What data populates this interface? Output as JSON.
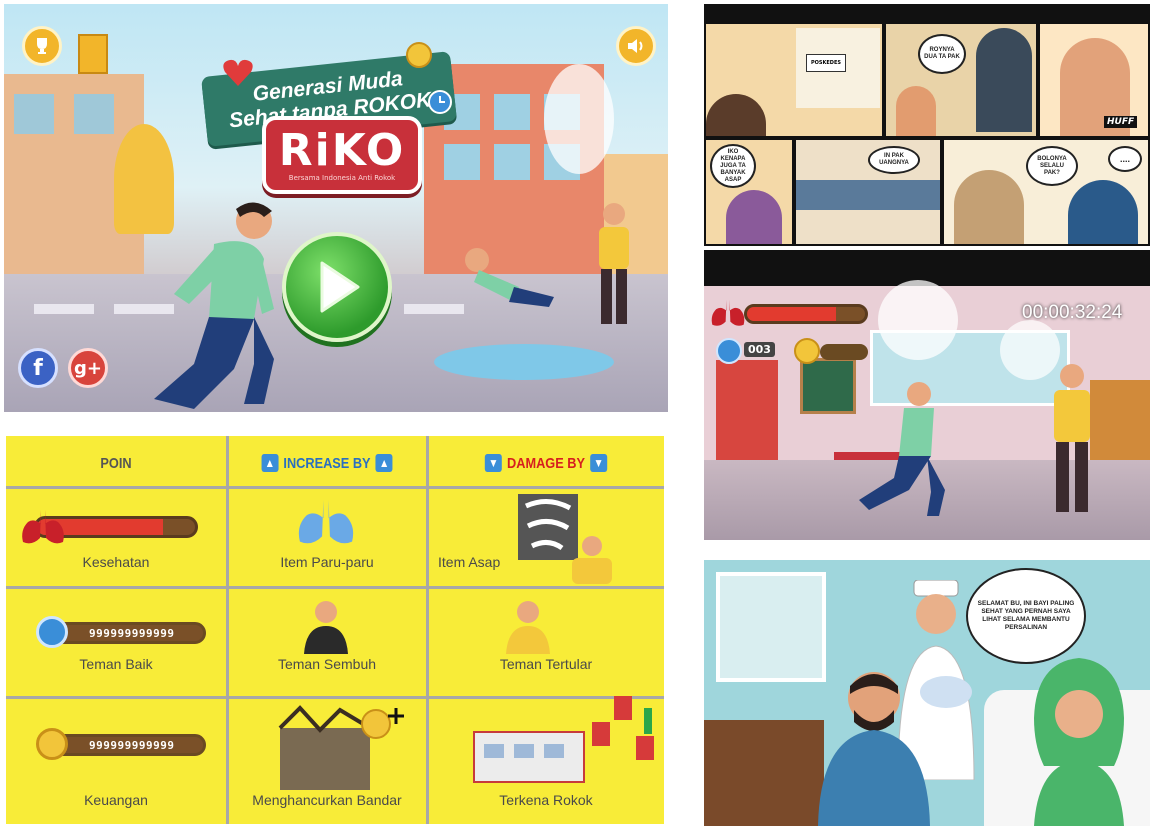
{
  "title_screen": {
    "slogan_line1": "Generasi Muda",
    "slogan_line2": "Sehat tanpa ROKOK",
    "logo_text": "RiKO",
    "logo_tagline": "Bersama Indonesia Anti Rokok",
    "icons": [
      "trophy-icon",
      "sound-icon",
      "facebook-icon",
      "google-plus-icon",
      "play-icon",
      "heart-icon"
    ],
    "social_facebook": "f",
    "social_google": "g+"
  },
  "points_table": {
    "headers": {
      "poin": "POIN",
      "increase": "INCREASE BY",
      "damage": "DAMAGE BY"
    },
    "rows": [
      {
        "poin_label": "Kesehatan",
        "increase_label": "Item Paru-paru",
        "damage_label": "Item Asap"
      },
      {
        "poin_label": "Teman Baik",
        "poin_value": "999999999999",
        "increase_label": "Teman Sembuh",
        "damage_label": "Teman Tertular"
      },
      {
        "poin_label": "Keuangan",
        "poin_value": "999999999999",
        "increase_label": "Menghancurkan Bandar",
        "damage_label": "Terkena Rokok"
      }
    ],
    "health_fill": 0.8,
    "colors": {
      "background": "#f8ec38",
      "increase_arrow": "#3a8ed8",
      "damage_text": "#d61f1f",
      "health_red": "#e23b2f"
    }
  },
  "comic": {
    "bubbles": [
      "ROYNYA DUA TA PAK",
      "HUFF",
      "IKO KENAPA JUGA TA BANYAK ASAP",
      "IN PAK UANGNYA",
      "BOLONYA SELALU PAK?",
      "....",
      "POSKEDES"
    ]
  },
  "gameplay": {
    "timer": "00:00:32:24",
    "friend_count": "003",
    "health_fill": 0.75
  },
  "hospital": {
    "speech": "SELAMAT BU, INI BAYI PALING SEHAT YANG PERNAH SAYA LIHAT SELAMA MEMBANTU PERSALINAN"
  }
}
